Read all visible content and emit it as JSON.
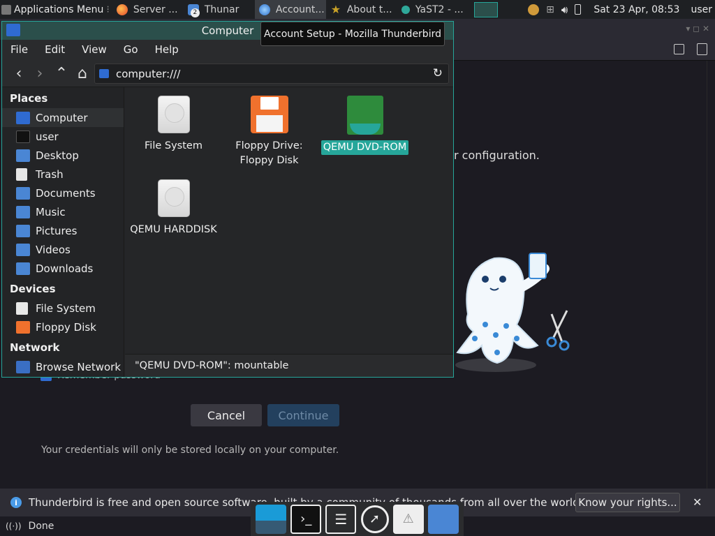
{
  "top_panel": {
    "apps_menu": "Applications Menu",
    "windows": [
      {
        "label": "Server ...",
        "icon": "firefox-icon",
        "badge": ""
      },
      {
        "label": "Thunar",
        "icon": "thunar-icon",
        "badge": "2"
      },
      {
        "label": "Account...",
        "icon": "thunderbird-icon",
        "badge": ""
      },
      {
        "label": "About t...",
        "icon": "star-icon",
        "badge": ""
      },
      {
        "label": "YaST2 - ...",
        "icon": "yast-icon",
        "badge": ""
      }
    ],
    "clock": "Sat 23 Apr, 08:53",
    "user": "user"
  },
  "tooltip": "Account Setup - Mozilla Thunderbird",
  "thunderbird": {
    "config_text": "r configuration.",
    "remember_label": "Remember password",
    "cancel_label": "Cancel",
    "continue_label": "Continue",
    "credentials_note": "Your credentials will only be stored locally on your computer.",
    "notification": "Thunderbird is free and open source software, built by a community of thousands from all over the world.",
    "know_rights_label": "Know your rights...",
    "status": "Done"
  },
  "thunar": {
    "title": "Computer",
    "menu": [
      "File",
      "Edit",
      "View",
      "Go",
      "Help"
    ],
    "location": "computer:///",
    "sections": {
      "places": "Places",
      "devices": "Devices",
      "network": "Network"
    },
    "places": [
      "Computer",
      "user",
      "Desktop",
      "Trash",
      "Documents",
      "Music",
      "Pictures",
      "Videos",
      "Downloads"
    ],
    "devices": [
      "File System",
      "Floppy Disk"
    ],
    "network": [
      "Browse Network"
    ],
    "files": [
      {
        "label": "File System"
      },
      {
        "label": "Floppy Drive:\nFloppy Disk"
      },
      {
        "label": "QEMU DVD-ROM"
      },
      {
        "label": "QEMU HARDDISK"
      }
    ],
    "status": "\"QEMU DVD-ROM\": mountable"
  },
  "colors": {
    "accent": "#26a69a",
    "folder": "#4a86d4",
    "floppy": "#f0712d",
    "dvd": "#2e8b3c"
  }
}
